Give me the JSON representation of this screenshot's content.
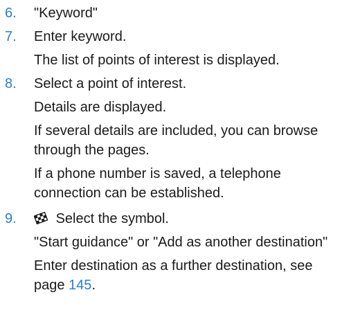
{
  "steps": [
    {
      "number": "6.",
      "text": "\"Keyword\""
    },
    {
      "number": "7.",
      "text": "Enter keyword."
    },
    {
      "number": "8.",
      "text": "Select a point of interest."
    },
    {
      "number": "9.",
      "text": "Select the symbol."
    }
  ],
  "notes": {
    "poi_list": "The list of points of interest is displayed.",
    "details": "Details are displayed.",
    "several_details": "If several details are included, you can browse through the pages.",
    "phone": "If a phone number is saved, a telephone connection can be established.",
    "guidance_options": "\"Start guidance\" or \"Add as another destination\"",
    "further_destination_prefix": "Enter destination as a further destination, see page ",
    "further_destination_page": "145",
    "further_destination_suffix": "."
  },
  "icons": {
    "step9": "checkered-flag-icon"
  },
  "colors": {
    "accent": "#2f7dc4",
    "text": "#1a1a1a"
  }
}
